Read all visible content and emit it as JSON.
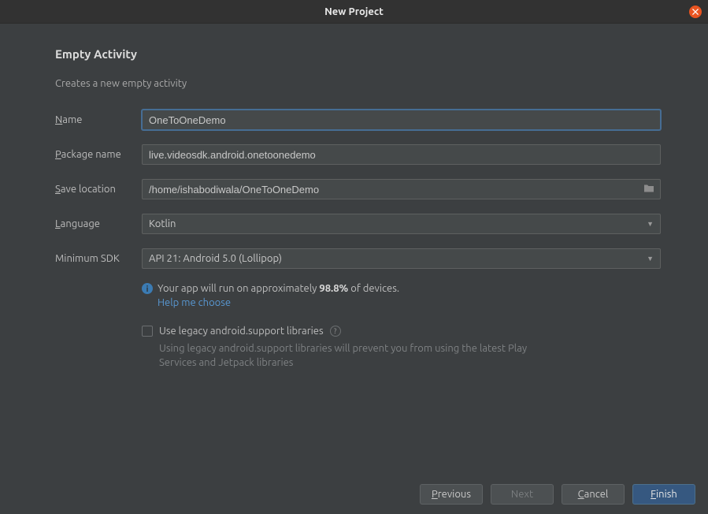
{
  "window": {
    "title": "New Project"
  },
  "heading": "Empty Activity",
  "subheading": "Creates a new empty activity",
  "labels": {
    "name": "ame",
    "package": "ackage name",
    "save": "ave location",
    "language": "anguage",
    "minsdk": "Minimum SDK"
  },
  "underline": {
    "name": "N",
    "package": "P",
    "save": "S",
    "language": "L"
  },
  "fields": {
    "name": "OneToOneDemo",
    "package": "live.videosdk.android.onetoonedemo",
    "save": "/home/ishabodiwala/OneToOneDemo",
    "language": "Kotlin",
    "minsdk": "API 21: Android 5.0 (Lollipop)"
  },
  "info": {
    "prefix": "Your app will run on approximately ",
    "percent": "98.8%",
    "suffix": " of devices.",
    "help": "Help me choose"
  },
  "legacy": {
    "label": "Use legacy android.support libraries",
    "desc": "Using legacy android.support libraries will prevent you from using the latest Play Services and Jetpack libraries"
  },
  "buttons": {
    "previous_ul": "P",
    "previous": "revious",
    "next": "Next",
    "cancel_ul": "C",
    "cancel": "ancel",
    "finish_ul": "F",
    "finish": "inish"
  }
}
